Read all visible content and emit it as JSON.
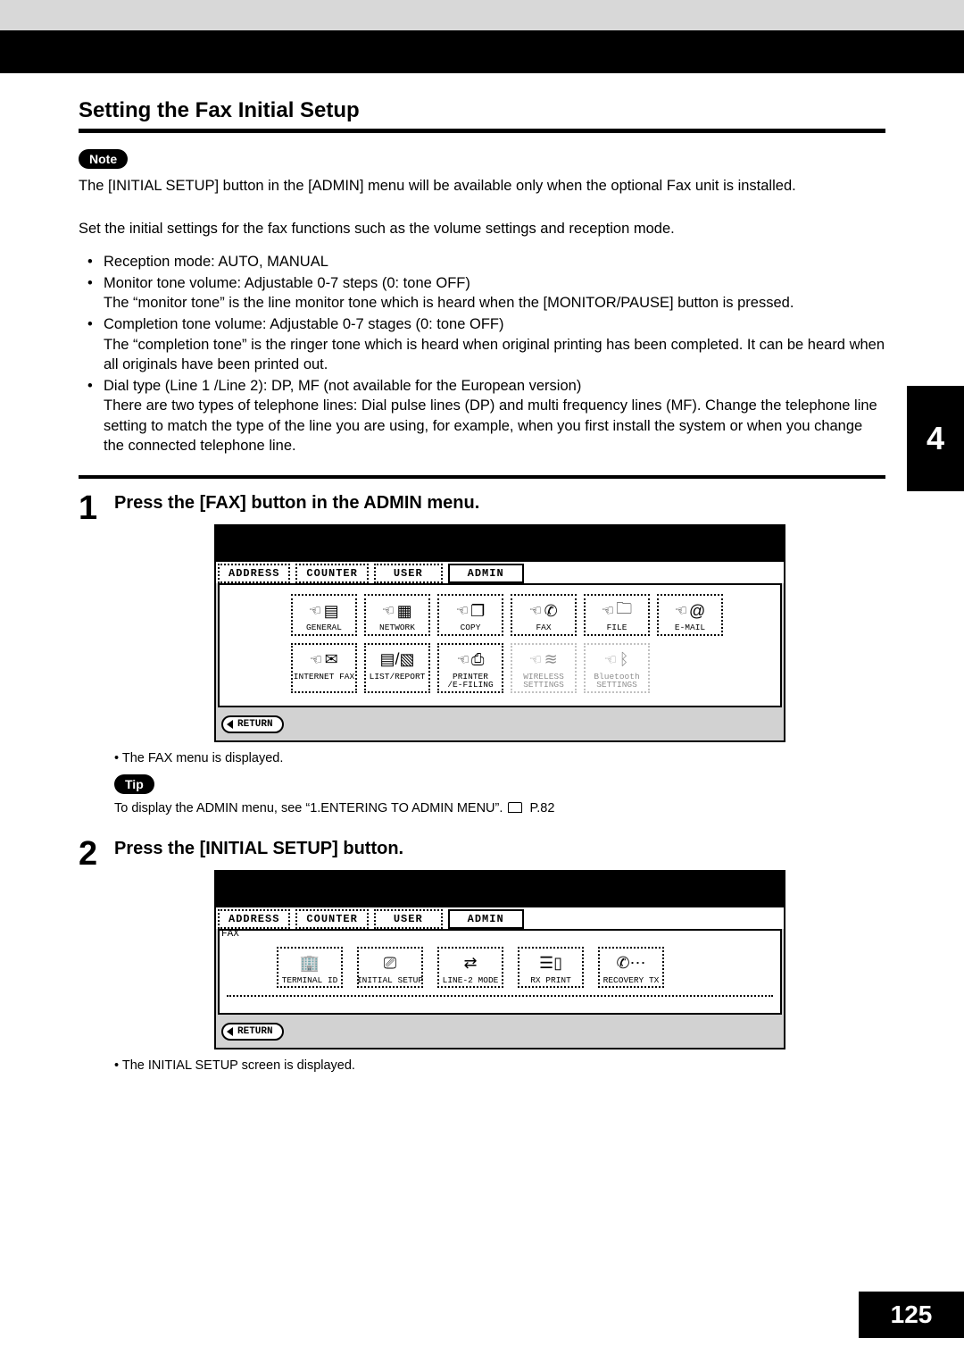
{
  "page": {
    "chapter_number": "4",
    "page_number": "125"
  },
  "heading": "Setting the Fax Initial Setup",
  "note": {
    "badge": "Note",
    "text": "The [INITIAL SETUP] button in the [ADMIN] menu will be available only when the optional Fax unit is installed."
  },
  "intro": "Set the initial settings for the fax functions such as the volume settings and reception mode.",
  "bullets": [
    {
      "line": "Reception mode: AUTO, MANUAL"
    },
    {
      "line": "Monitor tone volume: Adjustable 0-7 steps (0: tone OFF)",
      "sub": "The “monitor tone” is the line monitor tone which is heard when the [MONITOR/PAUSE] button is pressed."
    },
    {
      "line": "Completion tone volume: Adjustable 0-7 stages (0: tone OFF)",
      "sub": "The “completion tone” is the ringer tone which is heard when original printing has been completed. It can be heard when all originals have been printed out."
    },
    {
      "line": "Dial type (Line 1 /Line 2): DP, MF (not available for the European version)",
      "sub": "There are two types of telephone lines: Dial pulse lines (DP) and multi frequency lines (MF). Change the telephone line setting to match the type of the line you are using, for example, when you first install the system or when you change the connected telephone line."
    }
  ],
  "steps": [
    {
      "num": "1",
      "title": "Press the [FAX] button in the ADMIN menu.",
      "result": "The FAX menu is displayed.",
      "tip_badge": "Tip",
      "tip_text": "To display the ADMIN menu, see “1.ENTERING TO ADMIN MENU”.",
      "tip_ref": "P.82"
    },
    {
      "num": "2",
      "title": "Press the [INITIAL SETUP] button.",
      "result": "The INITIAL SETUP screen is displayed."
    }
  ],
  "lcd_common": {
    "tabs": [
      "ADDRESS",
      "COUNTER",
      "USER",
      "ADMIN"
    ],
    "return_label": "RETURN"
  },
  "lcd1": {
    "buttons_row1": [
      {
        "label": "GENERAL"
      },
      {
        "label": "NETWORK"
      },
      {
        "label": "COPY"
      },
      {
        "label": "FAX"
      },
      {
        "label": "FILE"
      },
      {
        "label": "E-MAIL"
      }
    ],
    "buttons_row2": [
      {
        "label": "INTERNET FAX"
      },
      {
        "label": "LIST/REPORT"
      },
      {
        "label": "PRINTER\n/E-FILING"
      },
      {
        "label": "WIRELESS\nSETTINGS",
        "dim": true
      },
      {
        "label": "Bluetooth\nSETTINGS",
        "dim": true
      }
    ]
  },
  "lcd2": {
    "crumb": "FAX",
    "buttons": [
      {
        "label": "TERMINAL ID"
      },
      {
        "label": "INITIAL SETUP"
      },
      {
        "label": "LINE-2 MODE"
      },
      {
        "label": "RX PRINT"
      },
      {
        "label": "RECOVERY TX"
      }
    ]
  }
}
